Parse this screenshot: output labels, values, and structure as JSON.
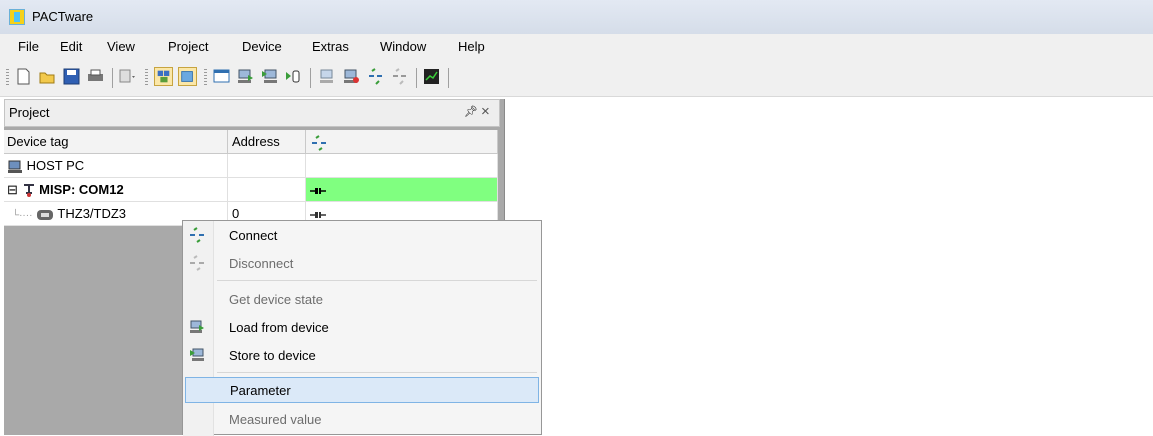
{
  "window": {
    "title": "PACTware"
  },
  "menubar": {
    "items": [
      "File",
      "Edit",
      "View",
      "Project",
      "Device",
      "Extras",
      "Window",
      "Help"
    ]
  },
  "toolbar": {
    "buttons": [
      "new-icon",
      "open-folder-icon",
      "save-icon",
      "print-icon",
      "copy-dropdown-icon",
      "project-view-icon",
      "device-catalog-icon",
      "parameter-window-icon",
      "load-from-device-icon",
      "store-to-device-icon",
      "measured-value-icon",
      "connect-device-icon",
      "disconnect-device-icon",
      "connect-icon",
      "disconnect-icon",
      "trend-icon"
    ]
  },
  "project_panel": {
    "title": "Project",
    "columns": {
      "device_tag": "Device tag",
      "address": "Address",
      "status_icon": "connection-icon"
    },
    "rows": [
      {
        "tag": "HOST PC",
        "address": "",
        "status": "",
        "bold": false
      },
      {
        "tag": "MISP: COM12",
        "address": "",
        "status": "connected",
        "bold": true,
        "expander": "⊟"
      },
      {
        "tag": "THZ3/TDZ3",
        "address": "0",
        "status": "offline",
        "bold": false
      }
    ]
  },
  "context_menu": {
    "items": [
      {
        "label": "Connect",
        "icon": "connect-icon",
        "enabled": true
      },
      {
        "label": "Disconnect",
        "icon": "disconnect-icon",
        "enabled": false
      },
      {
        "label": "Get device state",
        "icon": "",
        "enabled": false
      },
      {
        "label": "Load from device",
        "icon": "load-from-device-icon",
        "enabled": true
      },
      {
        "label": "Store to device",
        "icon": "store-to-device-icon",
        "enabled": true
      },
      {
        "label": "Parameter",
        "icon": "",
        "enabled": true,
        "selected": true
      },
      {
        "label": "Measured value",
        "icon": "",
        "enabled": false
      }
    ]
  },
  "colors": {
    "status_connected": "#80ff80",
    "selection_bg": "#dbe9f8",
    "selection_border": "#7fb4e5"
  }
}
